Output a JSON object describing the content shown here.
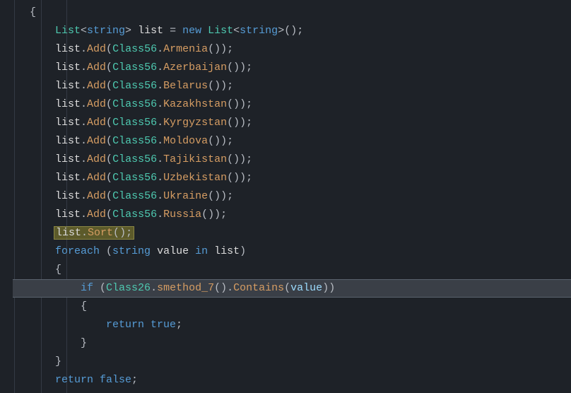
{
  "code": {
    "brace_open": "{",
    "brace_close": "}",
    "type_list": "List",
    "type_string": "string",
    "kw_new": "new",
    "kw_foreach": "foreach",
    "kw_if": "if",
    "kw_in": "in",
    "kw_return": "return",
    "kw_true": "true",
    "kw_false": "false",
    "var_list": "list",
    "var_value": "value",
    "method_add": "Add",
    "method_sort": "Sort",
    "method_contains": "Contains",
    "method_smethod7": "smethod_7",
    "class56": "Class56",
    "class26": "Class26",
    "assign": " = ",
    "lt": "<",
    "gt": ">",
    "lp": "(",
    "rp": ")",
    "dot": ".",
    "semi": ";",
    "space": " ",
    "countries": {
      "0": "Armenia",
      "1": "Azerbaijan",
      "2": "Belarus",
      "3": "Kazakhstan",
      "4": "Kyrgyzstan",
      "5": "Moldova",
      "6": "Tajikistan",
      "7": "Uzbekistan",
      "8": "Ukraine",
      "9": "Russia"
    }
  }
}
